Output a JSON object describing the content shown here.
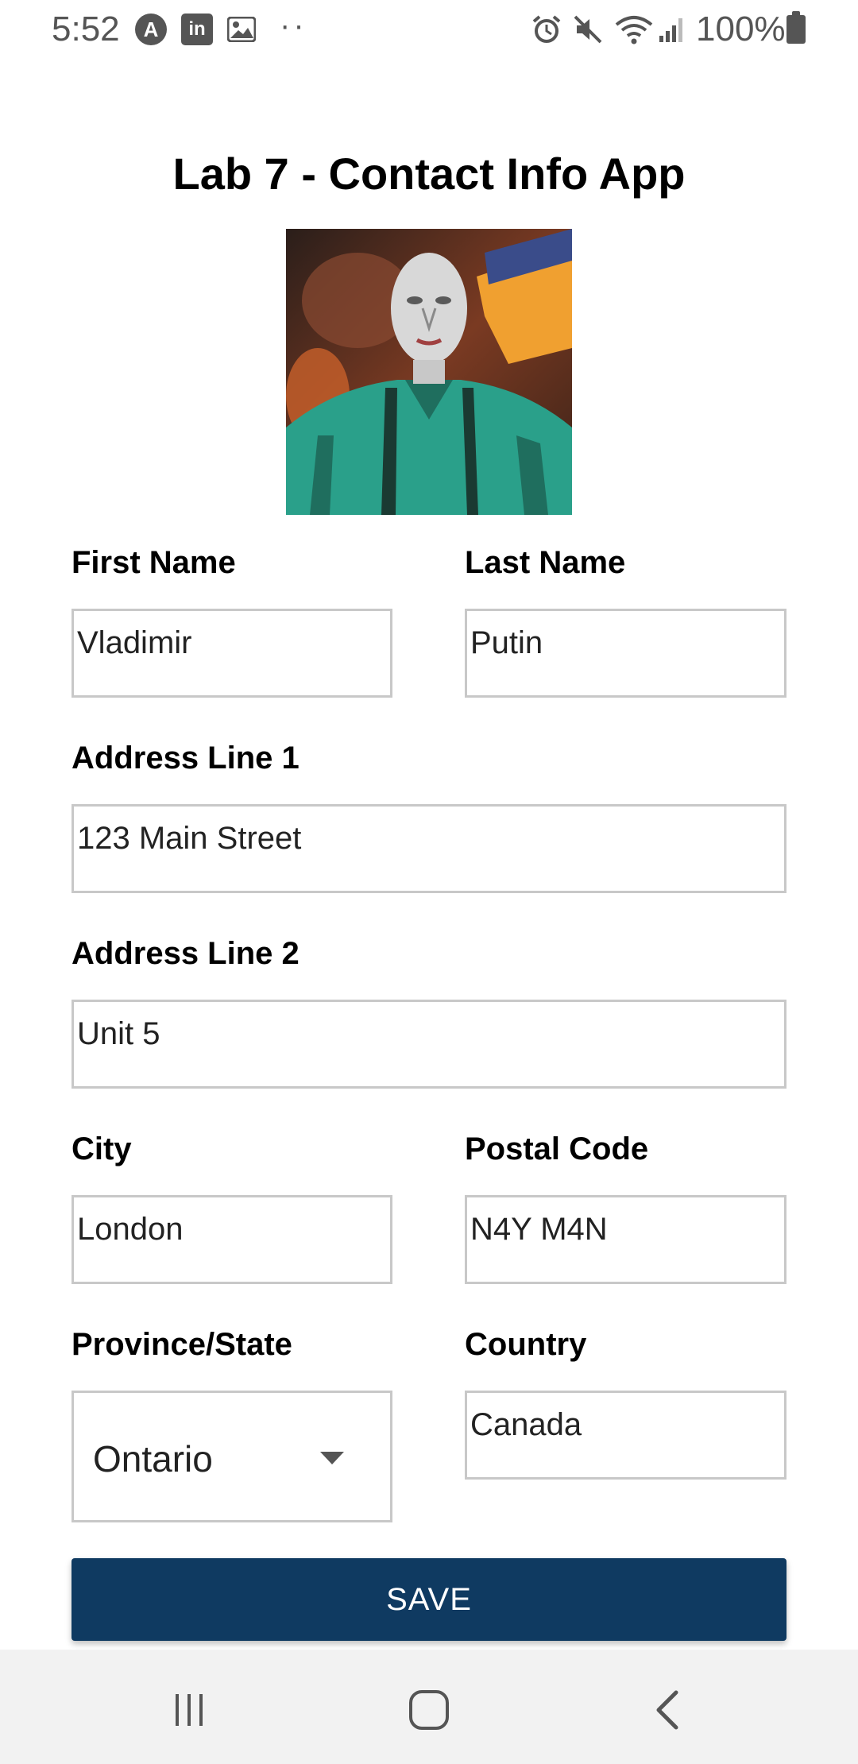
{
  "status_bar": {
    "time": "5:52",
    "notification_icons": [
      "app-icon",
      "linkedin-icon",
      "gallery-icon"
    ],
    "more_indicator": "··",
    "right_icons": [
      "alarm-icon",
      "mute-icon",
      "wifi-icon",
      "signal-icon"
    ],
    "battery_text": "100%"
  },
  "header": {
    "title": "Lab 7 - Contact Info App"
  },
  "profile": {
    "image_icon": "portrait-image"
  },
  "form": {
    "first_name": {
      "label": "First Name",
      "value": "Vladimir"
    },
    "last_name": {
      "label": "Last Name",
      "value": "Putin"
    },
    "address1": {
      "label": "Address Line 1",
      "value": "123 Main Street"
    },
    "address2": {
      "label": "Address Line 2",
      "value": "Unit 5"
    },
    "city": {
      "label": "City",
      "value": "London"
    },
    "postal_code": {
      "label": "Postal Code",
      "value": "N4Y M4N"
    },
    "province": {
      "label": "Province/State",
      "selected": "Ontario"
    },
    "country": {
      "label": "Country",
      "value": "Canada"
    }
  },
  "actions": {
    "save_label": "SAVE"
  },
  "nav_bar": {
    "icons": [
      "recent-apps-icon",
      "home-icon",
      "back-icon"
    ]
  },
  "colors": {
    "accent": "#0f3a61",
    "input_border": "#c8c8c8",
    "nav_bg": "#f2f2f2",
    "status_text": "#555555"
  }
}
